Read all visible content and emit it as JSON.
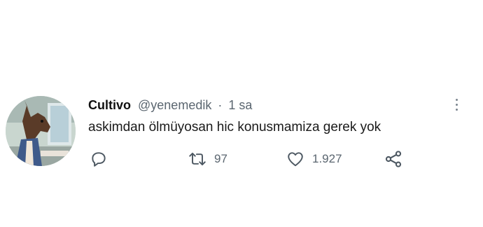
{
  "tweet": {
    "display_name": "Cultivo",
    "handle": "@yenemedik",
    "separator": "·",
    "time": "1 sa",
    "text": "askimdan ölmüyosan hic konusmamiza gerek yok",
    "retweet_count": "97",
    "like_count": "1.927"
  },
  "icons": {
    "reply": "reply-icon",
    "retweet": "retweet-icon",
    "like": "heart-icon",
    "share": "share-icon",
    "more": "more-vertical-icon"
  },
  "colors": {
    "muted_text": "#5b6670",
    "primary_text": "#111111",
    "background": "#ffffff"
  }
}
